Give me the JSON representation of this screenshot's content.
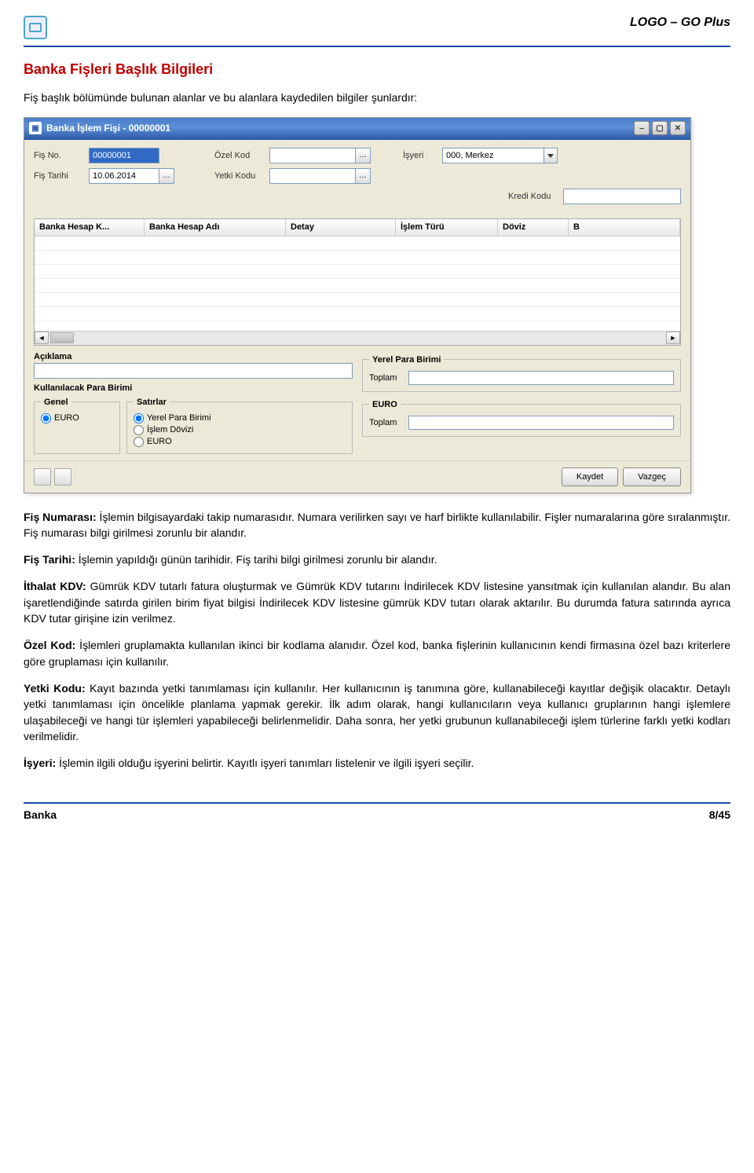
{
  "header": {
    "product": "LOGO – GO Plus"
  },
  "section": {
    "title": "Banka Fişleri Başlık Bilgileri",
    "intro": "Fiş başlık bölümünde bulunan alanlar ve bu alanlara kaydedilen bilgiler şunlardır:"
  },
  "window": {
    "title": "Banka İşlem Fişi - 00000001",
    "fields": {
      "fisno_label": "Fiş No.",
      "fisno_value": "00000001",
      "fistarihi_label": "Fiş Tarihi",
      "fistarihi_value": "10.06.2014",
      "ozelkod_label": "Özel Kod",
      "ozelkod_value": "",
      "yetkikodu_label": "Yetki Kodu",
      "yetkikodu_value": "",
      "isyeri_label": "İşyeri",
      "isyeri_value": "000, Merkez",
      "kredikodu_label": "Kredi Kodu",
      "kredikodu_value": ""
    },
    "grid": {
      "cols": [
        "Banka Hesap K...",
        "Banka Hesap Adı",
        "Detay",
        "İşlem Türü",
        "Döviz",
        "B"
      ]
    },
    "aciklama_label": "Açıklama",
    "kullanilacak_label": "Kullanılacak Para Birimi",
    "genel_legend": "Genel",
    "genel_option": "EURO",
    "satirlar_legend": "Satırlar",
    "satirlar_options": [
      "Yerel Para Birimi",
      "İşlem Dövizi",
      "EURO"
    ],
    "yerelpb_label": "Yerel Para Birimi",
    "euro_label": "EURO",
    "toplam_label": "Toplam",
    "save_label": "Kaydet",
    "cancel_label": "Vazgeç"
  },
  "paragraphs": {
    "p1a": "Fiş Numarası:",
    "p1b": " İşlemin bilgisayardaki takip numarasıdır. Numara verilirken sayı ve harf birlikte kullanılabilir. Fişler numaralarına göre sıralanmıştır. Fiş numarası bilgi girilmesi zorunlu bir alandır.",
    "p2a": "Fiş Tarihi:",
    "p2b": " İşlemin yapıldığı günün tarihidir. Fiş tarihi bilgi girilmesi zorunlu bir alandır.",
    "p3a": "İthalat KDV:",
    "p3b": " Gümrük KDV tutarlı fatura oluşturmak ve Gümrük KDV tutarını İndirilecek KDV listesine yansıtmak için kullanılan alandır. Bu alan işaretlendiğinde satırda girilen birim fiyat bilgisi İndirilecek KDV listesine gümrük KDV tutarı olarak aktarılır. Bu durumda fatura satırında ayrıca KDV tutar girişine izin verilmez.",
    "p4a": "Özel Kod:",
    "p4b": " İşlemleri gruplamakta kullanılan ikinci bir kodlama alanıdır. Özel kod, banka fişlerinin kullanıcının kendi firmasına özel bazı kriterlere göre gruplaması için kullanılır.",
    "p5a": "Yetki Kodu:",
    "p5b": " Kayıt bazında yetki tanımlaması için kullanılır. Her kullanıcının iş tanımına göre, kullanabileceği kayıtlar değişik olacaktır. Detaylı yetki tanımlaması için öncelikle planlama yapmak gerekir. İlk adım olarak, hangi kullanıcıların veya kullanıcı gruplarının hangi işlemlere ulaşabileceği ve hangi tür işlemleri yapabileceği belirlenmelidir. Daha sonra, her yetki grubunun kullanabileceği işlem türlerine farklı yetki kodları verilmelidir.",
    "p6a": "İşyeri:",
    "p6b": " İşlemin ilgili olduğu işyerini belirtir. Kayıtlı işyeri tanımları listelenir ve ilgili işyeri seçilir."
  },
  "footer": {
    "left": "Banka",
    "right": "8/45"
  }
}
